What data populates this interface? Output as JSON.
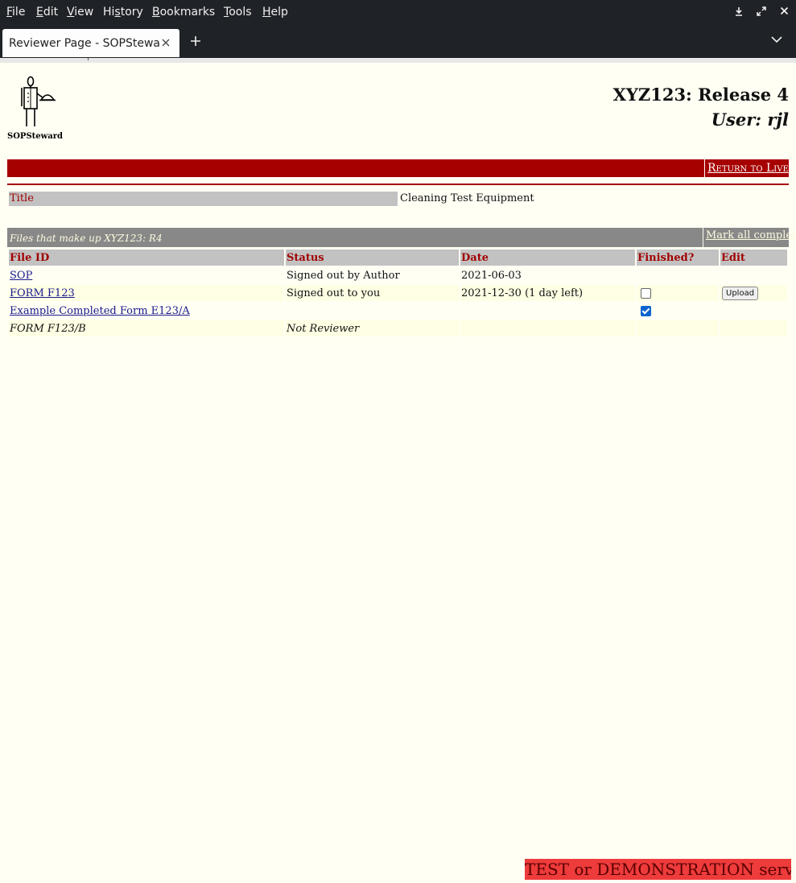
{
  "browser": {
    "menu": [
      {
        "pre": "",
        "u": "F",
        "post": "ile"
      },
      {
        "pre": "",
        "u": "E",
        "post": "dit"
      },
      {
        "pre": "",
        "u": "V",
        "post": "iew"
      },
      {
        "pre": "Hi",
        "u": "s",
        "post": "tory"
      },
      {
        "pre": "",
        "u": "B",
        "post": "ookmarks"
      },
      {
        "pre": "",
        "u": "T",
        "post": "ools"
      },
      {
        "pre": "",
        "u": "H",
        "post": "elp"
      }
    ],
    "tab_title": "Reviewer Page - SOPSteward",
    "icons": {
      "download": "download-icon",
      "fullscreen": "fullscreen-icon",
      "close": "close-icon",
      "new_tab": "plus-icon",
      "tab_list": "chevron-down-icon"
    }
  },
  "header": {
    "logo_caption": "SOPSteward",
    "release_title": "XYZ123: Release 4",
    "user_line": "User: rjl",
    "return_link": "Return to Live"
  },
  "document": {
    "title_label": "Title",
    "title_value": "Cleaning Test Equipment"
  },
  "files": {
    "caption": "Files that make up XYZ123: R4",
    "mark_all": "Mark all complete",
    "columns": [
      "File ID",
      "Status",
      "Date",
      "Finished?",
      "Edit"
    ],
    "rows": [
      {
        "file_id": "SOP",
        "status": "Signed out by Author",
        "date": "2021-06-03",
        "finished": null,
        "edit": ""
      },
      {
        "file_id": "FORM F123",
        "status": "Signed out to you",
        "date": "2021-12-30 (1 day left)",
        "finished": false,
        "edit": "Upload"
      },
      {
        "file_id": "Example Completed Form E123/A",
        "status": "",
        "date": "",
        "finished": true,
        "edit": ""
      },
      {
        "file_id": "FORM F123/B",
        "status": "Not Reviewer",
        "date": "",
        "finished": null,
        "edit": ""
      }
    ]
  },
  "footer": {
    "test_banner": "TEST or DEMONSTRATION server"
  },
  "colors": {
    "accent_red": "#a60000",
    "header_text_red": "#a00000",
    "page_bg": "#fffff4",
    "banner_red": "#ee3b3b"
  }
}
